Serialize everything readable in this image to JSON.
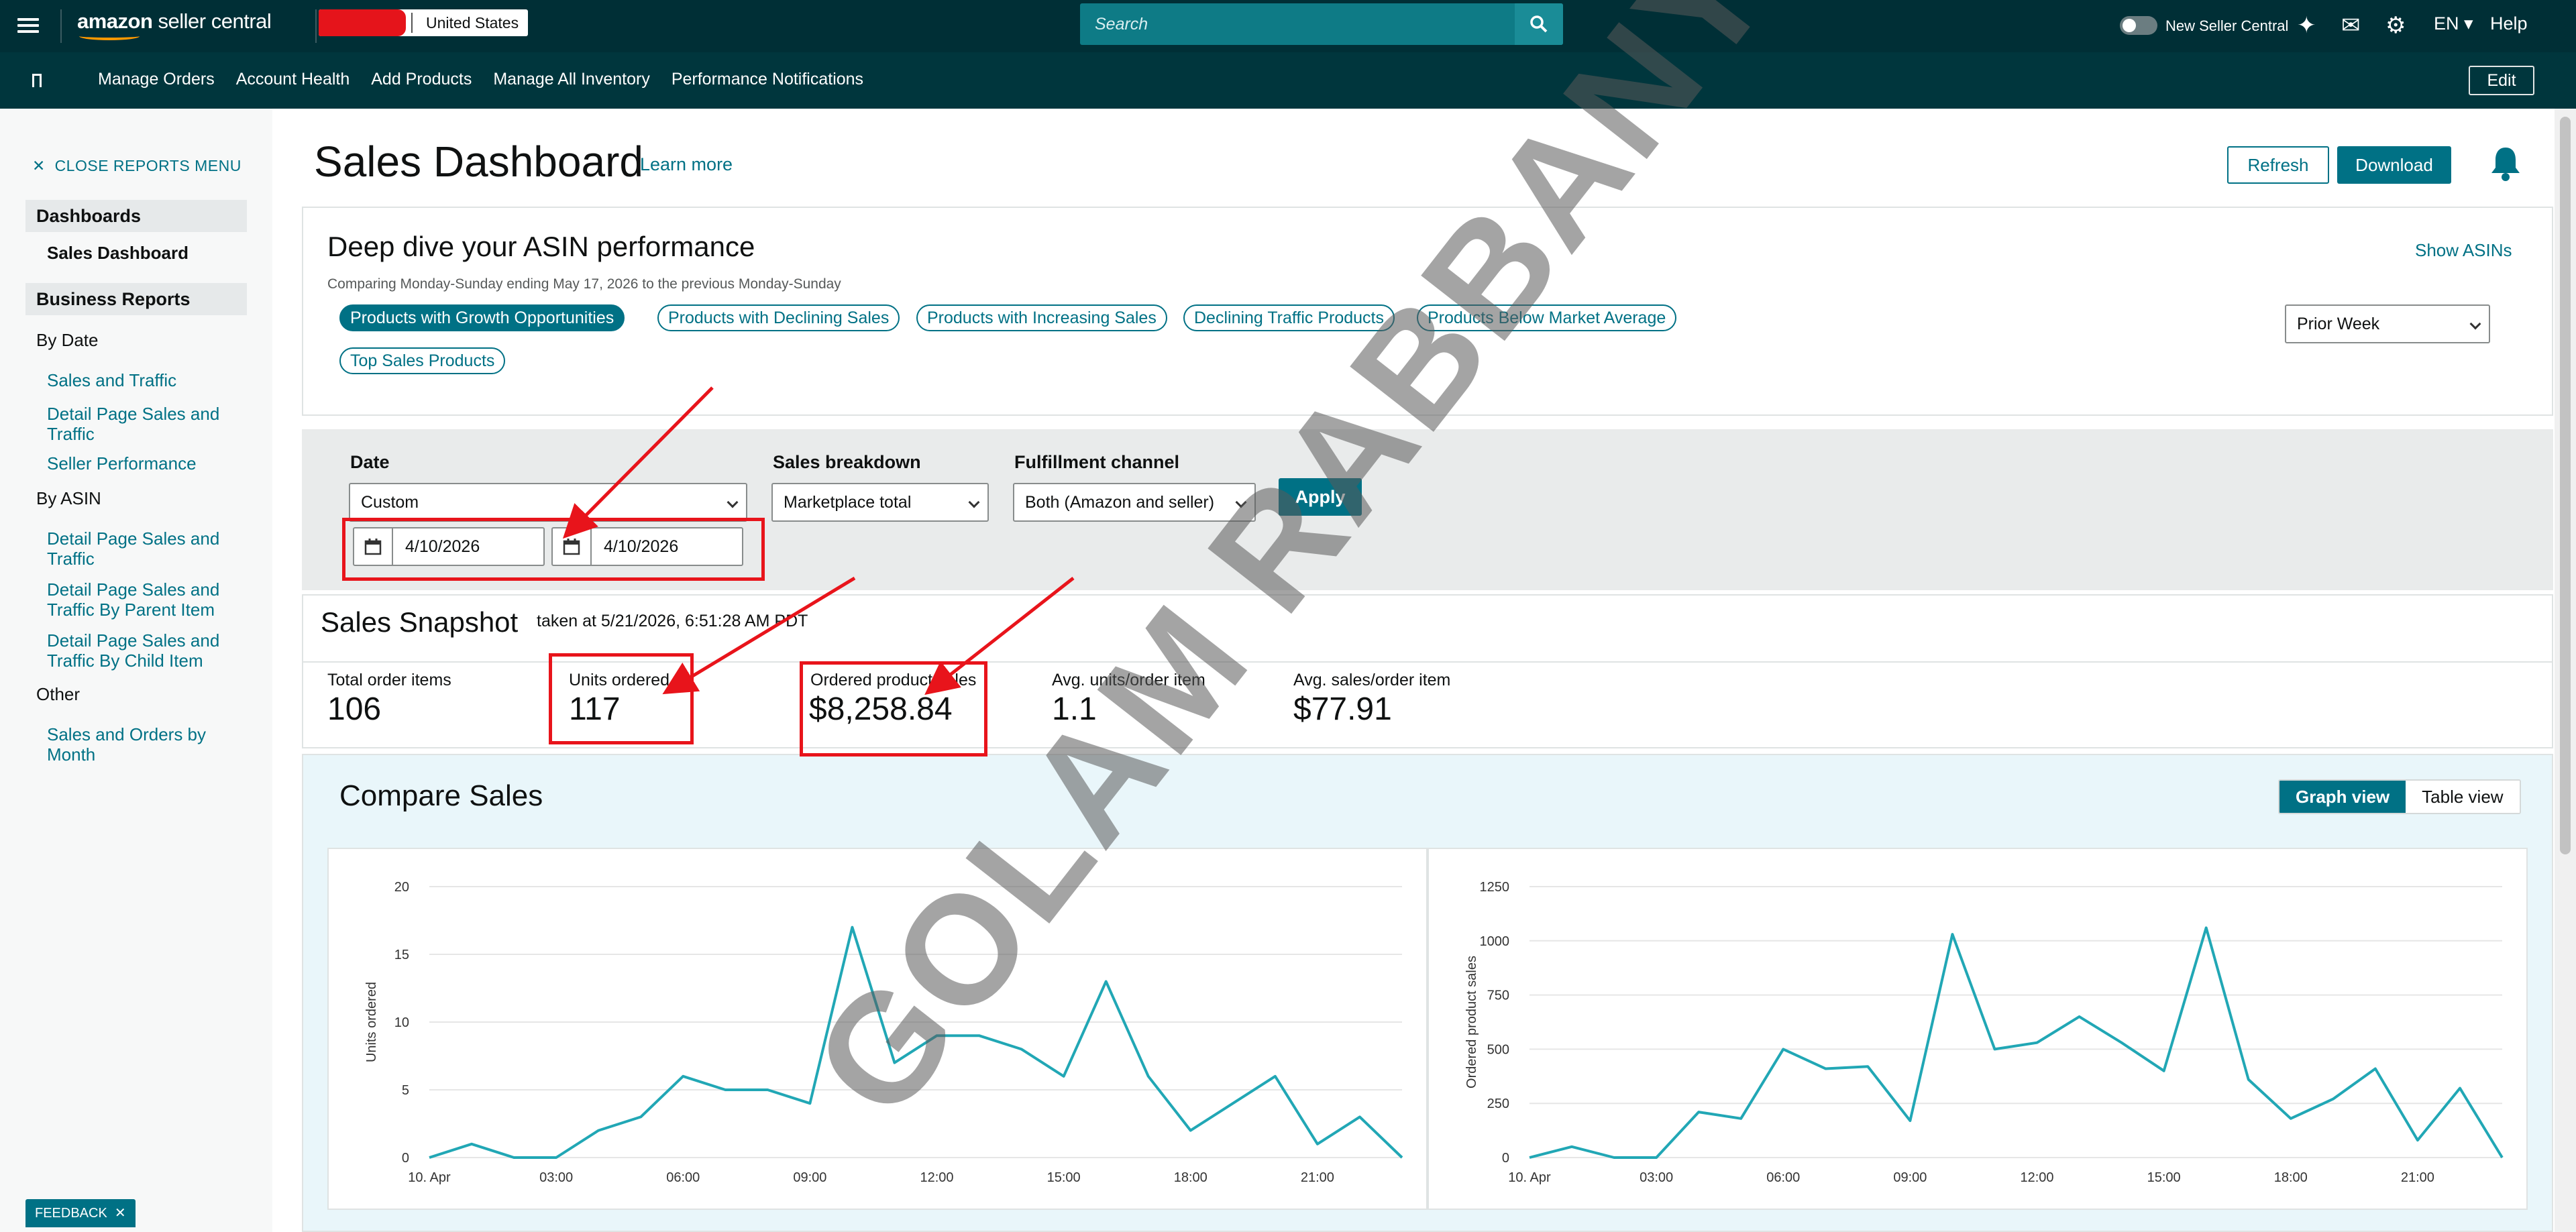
{
  "topbar": {
    "logo_bold": "amazon",
    "logo_light": " seller central",
    "country": "United States",
    "search_placeholder": "Search",
    "new_seller_central": "New Seller Central",
    "language": "EN",
    "help": "Help"
  },
  "navbar": {
    "links": [
      "Manage Orders",
      "Account Health",
      "Add Products",
      "Manage All Inventory",
      "Performance Notifications"
    ],
    "edit": "Edit"
  },
  "sidebar": {
    "close_menu": "CLOSE REPORTS MENU",
    "dashboards": "Dashboards",
    "sales_dashboard": "Sales Dashboard",
    "business_reports": "Business Reports",
    "by_date": "By Date",
    "by_date_items": [
      "Sales and Traffic",
      "Detail Page Sales and Traffic",
      "Seller Performance"
    ],
    "by_asin": "By ASIN",
    "by_asin_items": [
      "Detail Page Sales and Traffic",
      "Detail Page Sales and Traffic By Parent Item",
      "Detail Page Sales and Traffic By Child Item"
    ],
    "other": "Other",
    "other_items": [
      "Sales and Orders by Month"
    ]
  },
  "header": {
    "title": "Sales Dashboard",
    "learn_more": "Learn more",
    "refresh": "Refresh",
    "download": "Download"
  },
  "asin": {
    "title": "Deep dive your ASIN performance",
    "subtitle": "Comparing Monday-Sunday ending May 17, 2026 to the previous Monday-Sunday",
    "show_asins": "Show ASINs",
    "chips": [
      "Products with Growth Opportunities",
      "Products with Declining Sales",
      "Products with Increasing Sales",
      "Declining Traffic Products",
      "Products Below Market Average",
      "Top Sales Products"
    ],
    "period": "Prior Week"
  },
  "filters": {
    "date_label": "Date",
    "date_value": "Custom",
    "start_date": "4/10/2026",
    "end_date": "4/10/2026",
    "breakdown_label": "Sales breakdown",
    "breakdown_value": "Marketplace total",
    "channel_label": "Fulfillment channel",
    "channel_value": "Both (Amazon and seller)",
    "apply": "Apply"
  },
  "snapshot": {
    "title": "Sales Snapshot",
    "taken_at": "taken at 5/21/2026, 6:51:28 AM PDT",
    "metrics": [
      {
        "label": "Total order items",
        "value": "106"
      },
      {
        "label": "Units ordered",
        "value": "117"
      },
      {
        "label": "Ordered product sales",
        "value": "$8,258.84"
      },
      {
        "label": "Avg. units/order item",
        "value": "1.1"
      },
      {
        "label": "Avg. sales/order item",
        "value": "$77.91"
      }
    ]
  },
  "compare": {
    "title": "Compare Sales",
    "graph_view": "Graph view",
    "table_view": "Table view"
  },
  "watermark": "GOLAM RABBANY",
  "feedback": "FEEDBACK",
  "colors": {
    "accent": "#007185",
    "topbar": "#002f36",
    "navbar": "#00363d",
    "line": "#21a7b5",
    "annotation": "#e8141b"
  },
  "chart_data": [
    {
      "type": "line",
      "ylabel": "Units ordered",
      "ylim": [
        0,
        20
      ],
      "yticks": [
        0,
        5,
        10,
        15,
        20
      ],
      "xtick_labels": [
        "10. Apr",
        "03:00",
        "06:00",
        "09:00",
        "12:00",
        "15:00",
        "18:00",
        "21:00"
      ],
      "x": [
        0,
        1,
        2,
        3,
        4,
        5,
        6,
        7,
        8,
        9,
        10,
        11,
        12,
        13,
        14,
        15,
        16,
        17,
        18,
        19,
        20,
        21,
        22,
        23
      ],
      "values": [
        0,
        1,
        0,
        0,
        2,
        3,
        6,
        5,
        5,
        4,
        17,
        7,
        9,
        9,
        8,
        6,
        13,
        6,
        2,
        4,
        6,
        1,
        3,
        0
      ]
    },
    {
      "type": "line",
      "ylabel": "Ordered product sales",
      "ylim": [
        0,
        1250
      ],
      "yticks": [
        0,
        250,
        500,
        750,
        1000,
        1250
      ],
      "xtick_labels": [
        "10. Apr",
        "03:00",
        "06:00",
        "09:00",
        "12:00",
        "15:00",
        "18:00",
        "21:00"
      ],
      "x": [
        0,
        1,
        2,
        3,
        4,
        5,
        6,
        7,
        8,
        9,
        10,
        11,
        12,
        13,
        14,
        15,
        16,
        17,
        18,
        19,
        20,
        21,
        22,
        23
      ],
      "values": [
        0,
        50,
        0,
        0,
        210,
        180,
        500,
        410,
        420,
        170,
        1030,
        500,
        530,
        650,
        530,
        400,
        1060,
        360,
        180,
        270,
        410,
        80,
        320,
        0
      ]
    }
  ]
}
